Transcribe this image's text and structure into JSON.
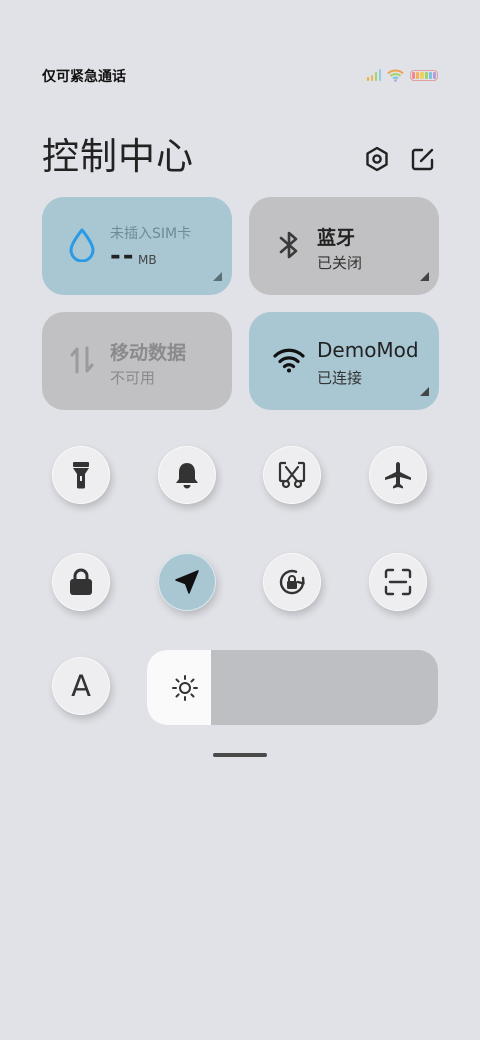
{
  "status_bar": {
    "text": "仅可紧急通话"
  },
  "header": {
    "title": "控制中心"
  },
  "tiles": {
    "data_usage": {
      "label": "未插入SIM卡",
      "value": "--",
      "unit": "MB"
    },
    "bluetooth": {
      "title": "蓝牙",
      "status": "已关闭"
    },
    "mobile_data": {
      "title": "移动数据",
      "status": "不可用"
    },
    "wifi": {
      "title": "DemoMode",
      "status": "已连接"
    }
  },
  "toggles": [
    {
      "name": "flashlight",
      "active": false
    },
    {
      "name": "bell",
      "active": false
    },
    {
      "name": "screenshot",
      "active": false
    },
    {
      "name": "airplane",
      "active": false
    },
    {
      "name": "lock-screen",
      "active": false
    },
    {
      "name": "location",
      "active": true
    },
    {
      "name": "rotation-lock",
      "active": false
    },
    {
      "name": "scanner",
      "active": false
    }
  ],
  "font_button": {
    "label": "A"
  },
  "brightness": {
    "level": 0.22
  },
  "colors": {
    "background": "#e1e2e7",
    "tile_active": "#a9c7d3",
    "tile_inactive": "#c1c1c3",
    "accent_blue": "#2b9ae6"
  }
}
